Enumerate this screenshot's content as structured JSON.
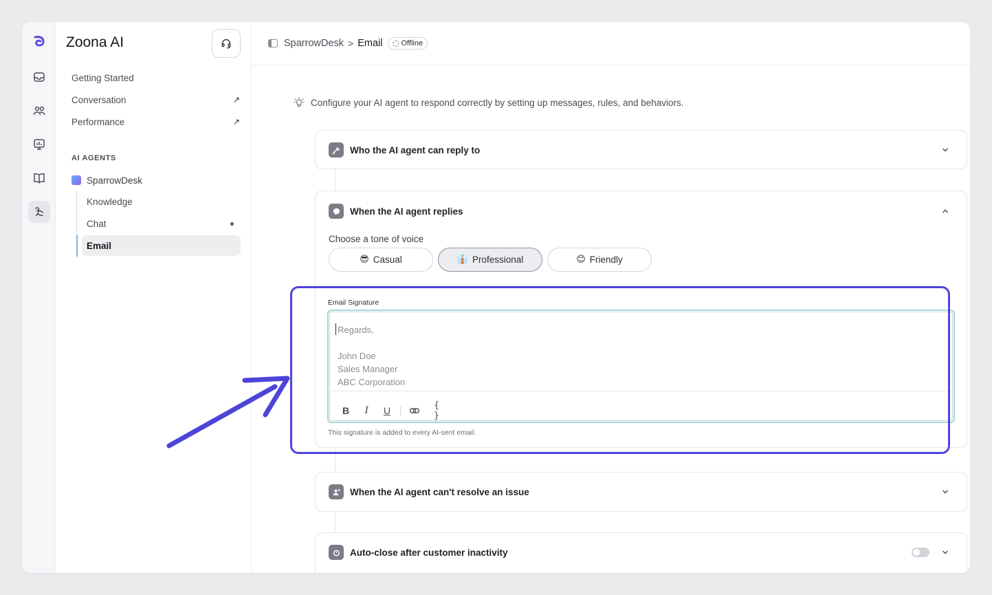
{
  "app": {
    "name": "Zoona AI"
  },
  "sidebar": {
    "items": [
      {
        "label": "Getting Started",
        "external": false
      },
      {
        "label": "Conversation",
        "external": true,
        "arrow": "↗"
      },
      {
        "label": "Performance",
        "external": true,
        "arrow": "↗"
      }
    ],
    "section_label": "AI AGENTS",
    "agent": {
      "label": "SparrowDesk"
    },
    "sub_items": [
      {
        "label": "Knowledge"
      },
      {
        "label": "Chat"
      },
      {
        "label": "Email"
      }
    ]
  },
  "rail_icons": [
    "logo-icon",
    "inbox-icon",
    "users-icon",
    "analytics-icon",
    "book-icon",
    "ai-agent-icon"
  ],
  "header": {
    "breadcrumb_root": "SparrowDesk",
    "breadcrumb_sep": ">",
    "breadcrumb_current": "Email",
    "status": "Offline"
  },
  "intro": {
    "text": "Configure your AI agent to respond correctly by setting up messages, rules, and behaviors."
  },
  "sections": {
    "who_reply": {
      "title": "Who the AI agent can reply to"
    },
    "when_replies": {
      "title": "When the AI agent replies",
      "tone_label": "Choose a tone of voice",
      "tones": [
        {
          "emoji": "😎",
          "label": "Casual"
        },
        {
          "emoji": "👔",
          "label": "Professional"
        },
        {
          "emoji": "😊",
          "label": "Friendly"
        }
      ],
      "selected_tone": "Professional"
    },
    "cant_resolve": {
      "title": "When the AI agent can't resolve an issue"
    },
    "auto_close": {
      "title": "Auto-close after customer inactivity",
      "enabled": false
    }
  },
  "signature": {
    "label": "Email Signature",
    "placeholder": "Regards,\n\nJohn Doe\nSales Manager\nABC Corporation",
    "help": "This signature is added to every AI-sent email.",
    "toolbar": {
      "bold": "B",
      "italic": "I",
      "underline": "U",
      "variable": "{ }"
    }
  },
  "colors": {
    "highlight": "#4d44d8",
    "signature_focus": "#a7d7d6",
    "active_tree": "#7fb3d5"
  }
}
